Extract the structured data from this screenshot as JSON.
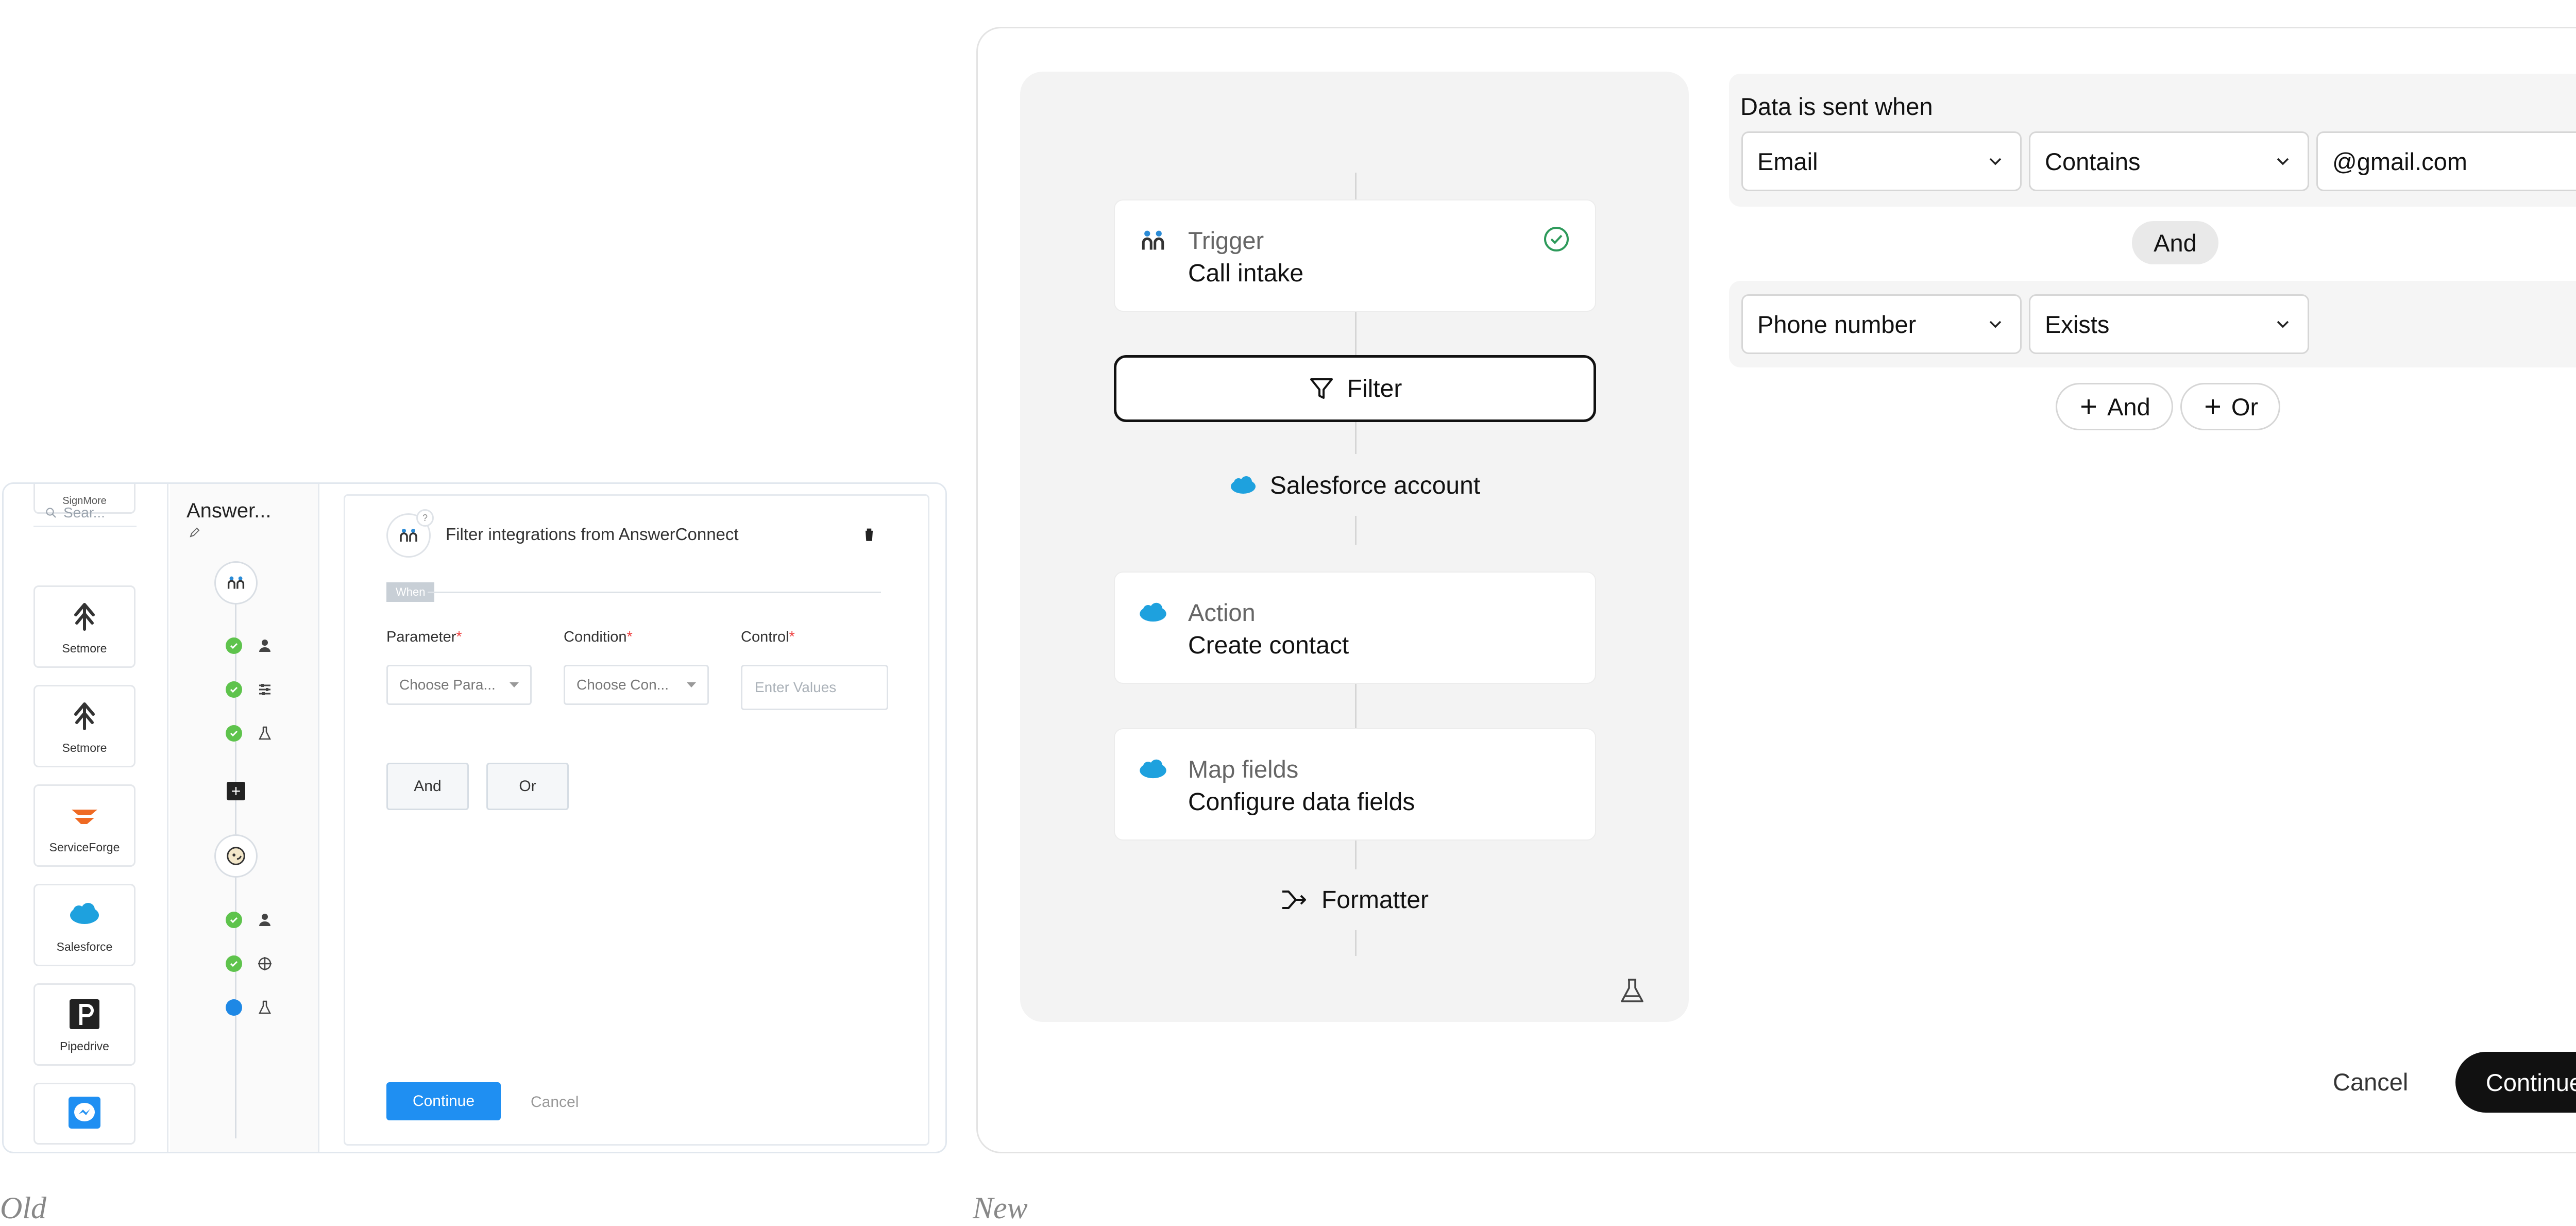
{
  "captions": {
    "old": "Old",
    "new": "New"
  },
  "old": {
    "search_placeholder": "Sear...",
    "apps": [
      {
        "name": "SignMore",
        "icon": "signmore-logo-icon"
      },
      {
        "name": "Setmore",
        "icon": "setmore-logo-icon"
      },
      {
        "name": "Setmore",
        "icon": "setmore-logo-icon"
      },
      {
        "name": "ServiceForge",
        "icon": "serviceforge-logo-icon"
      },
      {
        "name": "Salesforce",
        "icon": "salesforce-logo-icon"
      },
      {
        "name": "Pipedrive",
        "icon": "pipedrive-logo-icon"
      },
      {
        "name": "",
        "icon": "messenger-logo-icon"
      }
    ],
    "flow_title": "Answer...",
    "panel": {
      "title": "Filter integrations from AnswerConnect",
      "badge": "?",
      "when_label": "When",
      "fields": [
        {
          "label": "Parameter",
          "placeholder": "Choose Para..."
        },
        {
          "label": "Condition",
          "placeholder": "Choose Con..."
        },
        {
          "label": "Control",
          "placeholder": "Enter Values"
        }
      ],
      "required_mark": "*",
      "and_label": "And",
      "or_label": "Or",
      "continue_label": "Continue",
      "cancel_label": "Cancel"
    }
  },
  "new": {
    "flow": {
      "trigger": {
        "kind": "Trigger",
        "value": "Call intake",
        "status": "completed"
      },
      "filter_label": "Filter",
      "salesforce_label": "Salesforce account",
      "action": {
        "kind": "Action",
        "value": "Create contact"
      },
      "map": {
        "kind": "Map fields",
        "value": "Configure data fields"
      },
      "formatter_label": "Formatter"
    },
    "conditions": {
      "heading": "Data is sent when",
      "group1": {
        "field": "Email",
        "operator": "Contains",
        "value": "@gmail.com"
      },
      "join": "And",
      "group2": {
        "field": "Phone number",
        "operator": "Exists"
      },
      "add_and": "And",
      "add_or": "Or"
    },
    "cancel_label": "Cancel",
    "continue_label": "Continue"
  },
  "colors": {
    "accent_old": "#1f8ff2",
    "success": "#5ec34c",
    "primary_new": "#111111",
    "salesforce": "#1ea1de",
    "serviceforge": "#ef6a23"
  }
}
